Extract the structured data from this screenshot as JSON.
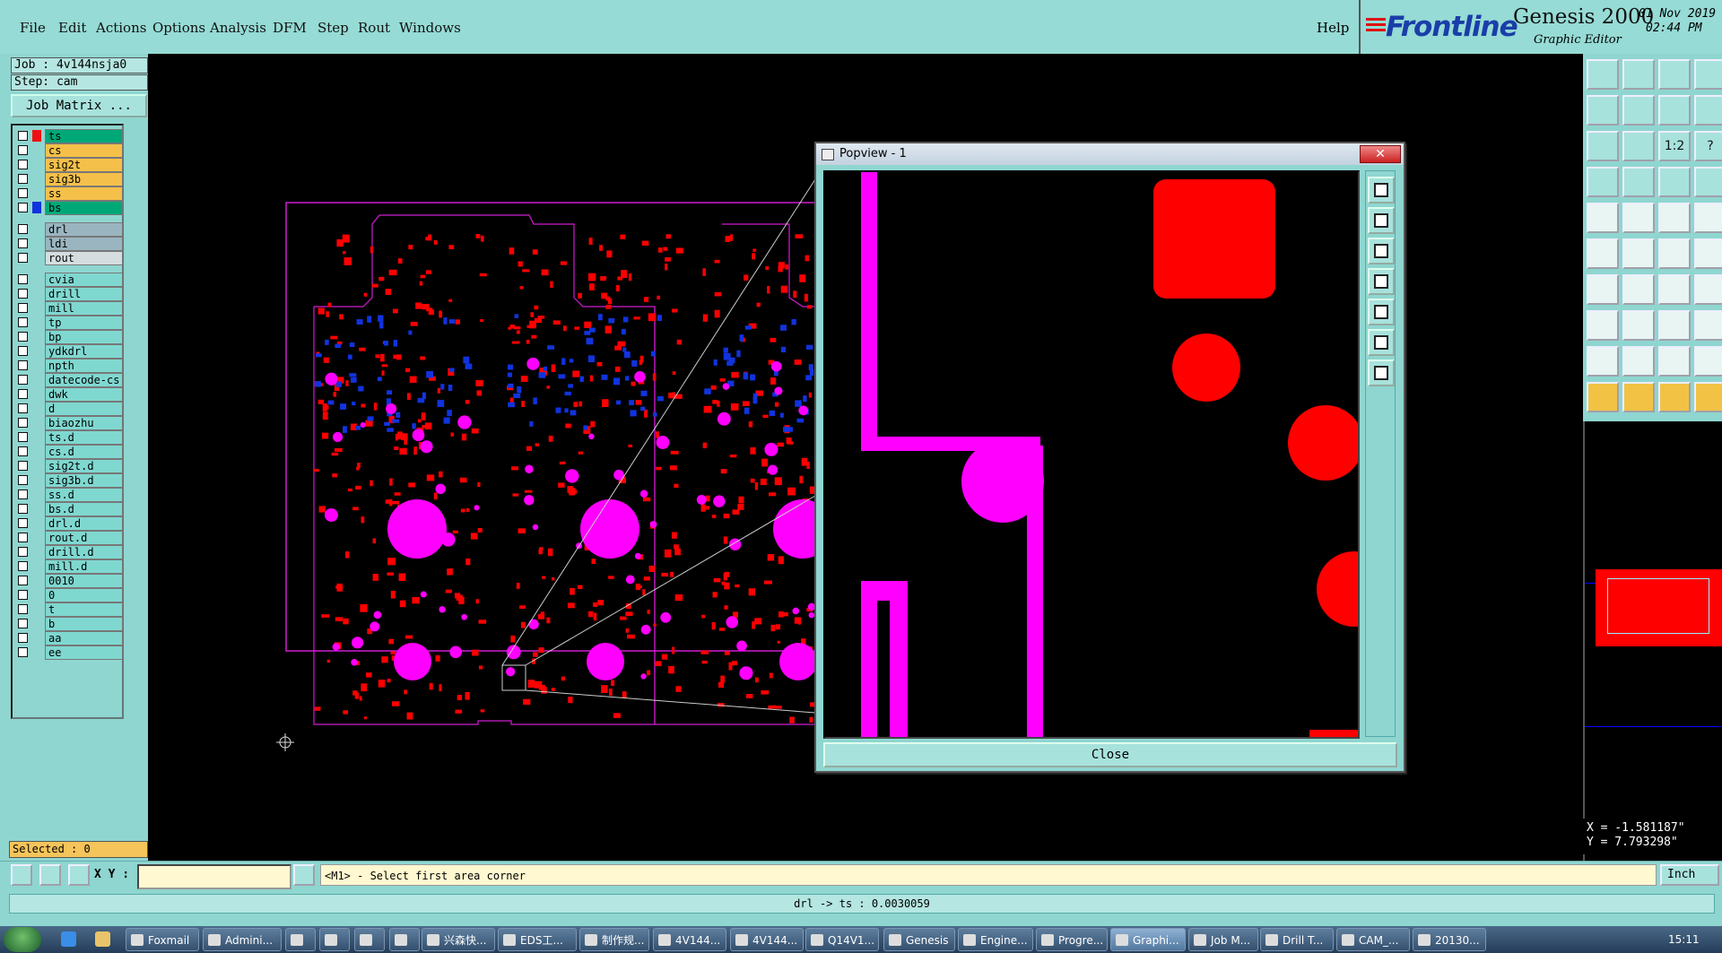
{
  "menu": {
    "items": [
      "File",
      "Edit",
      "Actions",
      "Options",
      "Analysis",
      "DFM",
      "Step",
      "Rout",
      "Windows"
    ],
    "help": "Help"
  },
  "brand": {
    "logo": "Frontline",
    "product": "Genesis 2000",
    "subtitle": "Graphic Editor",
    "date": "01 Nov 2019",
    "time": "02:44 PM"
  },
  "job": {
    "job_label": "Job : 4v144nsja0",
    "step_label": "Step: cam",
    "matrix_button": "Job Matrix ..."
  },
  "layers": [
    {
      "name": "ts",
      "color": "#00a878",
      "swatch": "#e11"
    },
    {
      "name": "cs",
      "color": "#f5c04a",
      "swatch": ""
    },
    {
      "name": "sig2t",
      "color": "#f5c04a",
      "swatch": ""
    },
    {
      "name": "sig3b",
      "color": "#f5c04a",
      "swatch": ""
    },
    {
      "name": "ss",
      "color": "#f5c04a",
      "swatch": ""
    },
    {
      "name": "bs",
      "color": "#00a878",
      "swatch": "#1133dd"
    },
    {
      "name": "drl",
      "color": "#9ab5c0",
      "swatch": ""
    },
    {
      "name": "ldi",
      "color": "#9ab5c0",
      "swatch": ""
    },
    {
      "name": "rout",
      "color": "#d5dde0",
      "swatch": ""
    },
    {
      "name": "cvia",
      "color": "#7fd8d0",
      "swatch": ""
    },
    {
      "name": "drill",
      "color": "#7fd8d0",
      "swatch": ""
    },
    {
      "name": "mill",
      "color": "#7fd8d0",
      "swatch": ""
    },
    {
      "name": "tp",
      "color": "#7fd8d0",
      "swatch": ""
    },
    {
      "name": "bp",
      "color": "#7fd8d0",
      "swatch": ""
    },
    {
      "name": "ydkdrl",
      "color": "#7fd8d0",
      "swatch": ""
    },
    {
      "name": "npth",
      "color": "#7fd8d0",
      "swatch": ""
    },
    {
      "name": "datecode-cs",
      "color": "#7fd8d0",
      "swatch": ""
    },
    {
      "name": "dwk",
      "color": "#7fd8d0",
      "swatch": ""
    },
    {
      "name": "d",
      "color": "#7fd8d0",
      "swatch": ""
    },
    {
      "name": "biaozhu",
      "color": "#7fd8d0",
      "swatch": ""
    },
    {
      "name": "ts.d",
      "color": "#7fd8d0",
      "swatch": ""
    },
    {
      "name": "cs.d",
      "color": "#7fd8d0",
      "swatch": ""
    },
    {
      "name": "sig2t.d",
      "color": "#7fd8d0",
      "swatch": ""
    },
    {
      "name": "sig3b.d",
      "color": "#7fd8d0",
      "swatch": ""
    },
    {
      "name": "ss.d",
      "color": "#7fd8d0",
      "swatch": ""
    },
    {
      "name": "bs.d",
      "color": "#7fd8d0",
      "swatch": ""
    },
    {
      "name": "drl.d",
      "color": "#7fd8d0",
      "swatch": ""
    },
    {
      "name": "rout.d",
      "color": "#7fd8d0",
      "swatch": ""
    },
    {
      "name": "drill.d",
      "color": "#7fd8d0",
      "swatch": ""
    },
    {
      "name": "mill.d",
      "color": "#7fd8d0",
      "swatch": ""
    },
    {
      "name": "0010",
      "color": "#7fd8d0",
      "swatch": ""
    },
    {
      "name": "0",
      "color": "#7fd8d0",
      "swatch": ""
    },
    {
      "name": "t",
      "color": "#7fd8d0",
      "swatch": ""
    },
    {
      "name": "b",
      "color": "#7fd8d0",
      "swatch": ""
    },
    {
      "name": "aa",
      "color": "#7fd8d0",
      "swatch": ""
    },
    {
      "name": "ee",
      "color": "#7fd8d0",
      "swatch": ""
    }
  ],
  "selected": "Selected : 0",
  "popview": {
    "title": "Popview - 1",
    "close_label": "Close"
  },
  "toolbar_labels": {
    "ratio": "1:2",
    "question": "?"
  },
  "coords": {
    "x": "X = -1.581187\"",
    "y": "Y = 7.793298\""
  },
  "command": {
    "xy_label": "X Y :",
    "input_value": "",
    "prompt": "<M1> - Select first area corner",
    "units": "Inch"
  },
  "status": "drl -> ts : 0.0030059",
  "taskbar": {
    "tasks": [
      "Foxmail",
      "Admini...",
      "",
      "",
      "",
      "",
      "兴森快...",
      "EDS工...",
      "制作规...",
      "4V144...",
      "4V144...",
      "Q14V1...",
      "Genesis",
      "Engine...",
      "Progre...",
      "Graphi...",
      "Job M...",
      "Drill T...",
      "CAM_...",
      "20130..."
    ],
    "clock": "15:11"
  },
  "colors": {
    "panel": "#8fd6d0",
    "copper_top": "#ff0000",
    "copper_bottom": "#1133dd",
    "drill": "#ff00ff",
    "selected_bg": "#f5c45a"
  }
}
